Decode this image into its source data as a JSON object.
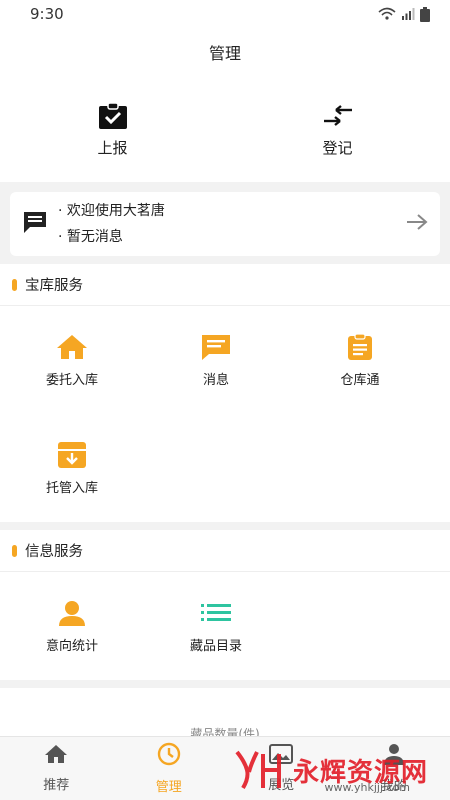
{
  "status": {
    "time": "9:30"
  },
  "header": {
    "title": "管理"
  },
  "top_actions": [
    {
      "label": "上报",
      "icon": "clipboard-check-icon"
    },
    {
      "label": "登记",
      "icon": "swap-arrows-icon"
    }
  ],
  "messages": {
    "lines": [
      "· 欢迎使用大茗唐",
      "· 暂无消息"
    ]
  },
  "vault_services": {
    "title": "宝库服务",
    "items": [
      {
        "label": "委托入库",
        "icon": "home-icon"
      },
      {
        "label": "消息",
        "icon": "message-icon"
      },
      {
        "label": "仓库通",
        "icon": "clipboard-list-icon"
      },
      {
        "label": "托管入库",
        "icon": "archive-icon"
      }
    ]
  },
  "info_services": {
    "title": "信息服务",
    "items": [
      {
        "label": "意向统计",
        "icon": "person-icon"
      },
      {
        "label": "藏品目录",
        "icon": "list-icon"
      }
    ]
  },
  "stats": {
    "label": "藏品数量(件)"
  },
  "tabs": [
    {
      "label": "推荐",
      "icon": "home-icon",
      "active": false
    },
    {
      "label": "管理",
      "icon": "clock-icon",
      "active": true
    },
    {
      "label": "展览",
      "icon": "gallery-icon",
      "active": false
    },
    {
      "label": "我的",
      "icon": "person-icon",
      "active": false
    }
  ],
  "watermark": {
    "text": "永辉资源网",
    "url": "www.yhkjjj.com"
  },
  "colors": {
    "accent": "#f5a623",
    "green": "#2ec4a0",
    "watermark_red": "#e3202a"
  }
}
